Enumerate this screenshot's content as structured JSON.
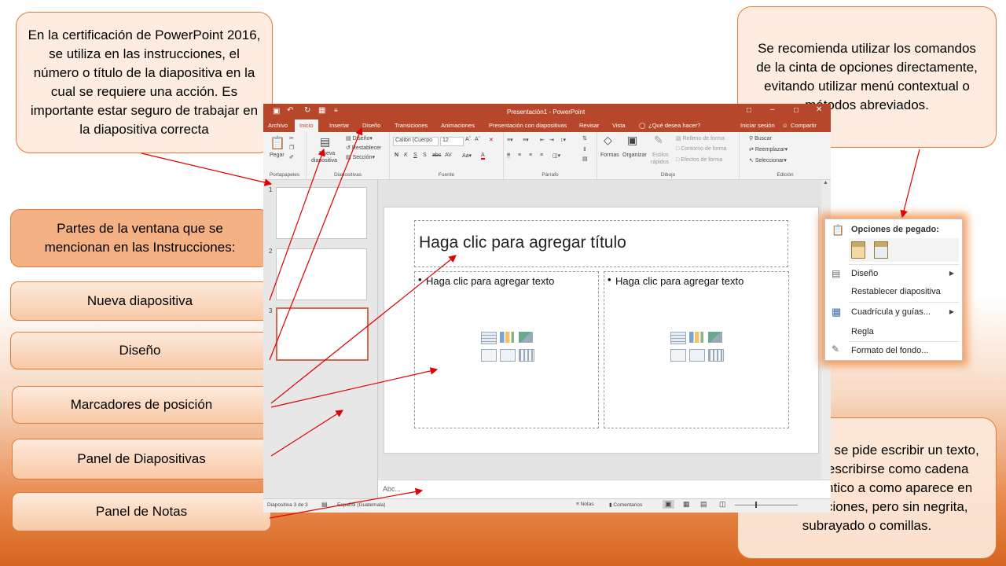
{
  "callouts": {
    "certificacion": "En la certificación de PowerPoint 2016, se utiliza en las instrucciones, el número o título de la diapositiva en la cual se requiere una acción. Es importante estar seguro de trabajar en la diapositiva correcta",
    "cinta": "Se recomienda utilizar los comandos de la cinta de opciones directamente, evitando utilizar menú contextual o métodos abreviados.",
    "texto": "Siempre que se pide escribir un texto, este debe escribirse como cadena exacta, idéntico a como aparece en las instrucciones, pero sin negrita, subrayado o comillas."
  },
  "labels": {
    "header": "Partes de la ventana que se mencionan en las Instrucciones:",
    "nueva": "Nueva diapositiva",
    "diseno": "Diseño",
    "marcadores": "Marcadores de posición",
    "panel_diap": "Panel de Diapositivas",
    "panel_notas": "Panel de Notas"
  },
  "ppt": {
    "window_title": "Presentación1 - PowerPoint",
    "tabs": [
      "Archivo",
      "Inicio",
      "Insertar",
      "Diseño",
      "Transiciones",
      "Animaciones",
      "Presentación con diapositivas",
      "Revisar",
      "Vista"
    ],
    "tell_me": "¿Qué desea hacer?",
    "signin": "Iniciar sesión",
    "share": "Compartir",
    "ribbon": {
      "paste": "Pegar",
      "clipboard": "Portapapeles",
      "new_slide_line1": "Nueva",
      "new_slide_line2": "diapositiva",
      "layout": "Diseño",
      "reset": "Restablecer",
      "section": "Sección",
      "slides_group": "Diapositivas",
      "font_name": "Calibri (Cuerpo",
      "font_size": "12",
      "font_group": "Fuente",
      "paragraph_group": "Párrafo",
      "shapes": "Formas",
      "arrange": "Organizar",
      "quick_styles_line1": "Estilos",
      "quick_styles_line2": "rápidos",
      "fill": "Relleno de forma",
      "outline": "Contorno de forma",
      "effects": "Efectos de forma",
      "drawing_group": "Dibujo",
      "find": "Buscar",
      "replace": "Reemplazar",
      "select": "Seleccionar",
      "editing_group": "Edición"
    },
    "thumb_numbers": [
      "1",
      "2",
      "3"
    ],
    "slide": {
      "title_placeholder": "Haga clic para agregar título",
      "left_text": "Haga clic para agregar texto",
      "right_text": "Haga clic para agregar texto"
    },
    "notes_text": "Abc...",
    "status": {
      "slide_counter": "Diapositiva 3 de 3",
      "language": "Español (Guatemala)",
      "notes": "Notas",
      "comments": "Comentarios"
    }
  },
  "context_menu": {
    "paste_header": "Opciones de pegado:",
    "items": [
      "Diseño",
      "Restablecer diapositiva",
      "Cuadrícula y guías...",
      "Regla",
      "Formato del fondo..."
    ]
  },
  "colors": {
    "accent": "#b7472a",
    "callout_border": "#e07b39",
    "arrow": "#e00000"
  }
}
